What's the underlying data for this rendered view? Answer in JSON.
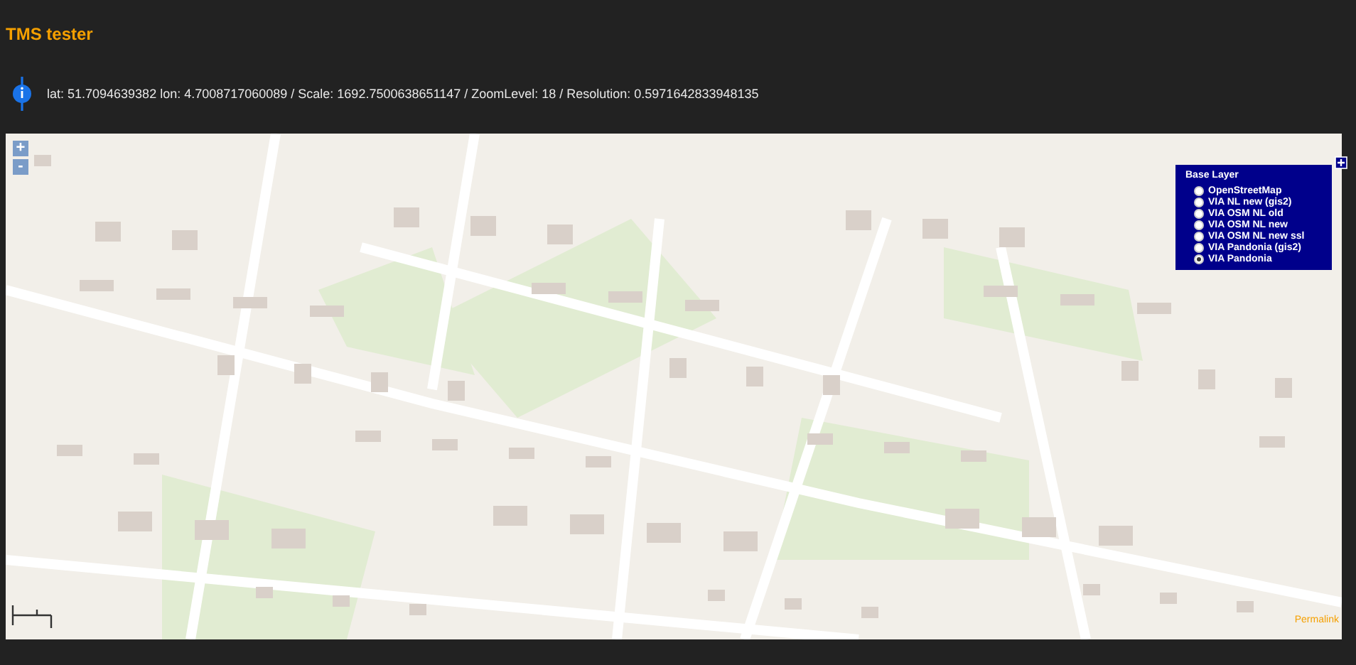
{
  "title": "TMS tester",
  "info": {
    "text": "lat: 51.7094639382 lon: 4.7008717060089 / Scale: 1692.7500638651147 / ZoomLevel: 18 / Resolution: 0.5971642833948135"
  },
  "map": {
    "zoom_in": "+",
    "zoom_out": "-",
    "permalink": "Permalink",
    "layer_switcher": {
      "heading": "Base Layer",
      "layers": [
        {
          "label": "OpenStreetMap",
          "selected": false
        },
        {
          "label": "VIA NL new (gis2)",
          "selected": false
        },
        {
          "label": "VIA OSM NL old",
          "selected": false
        },
        {
          "label": "VIA OSM NL new",
          "selected": false
        },
        {
          "label": "VIA OSM NL new ssl",
          "selected": false
        },
        {
          "label": "VIA Pandonia (gis2)",
          "selected": false
        },
        {
          "label": "VIA Pandonia",
          "selected": true
        }
      ]
    }
  }
}
